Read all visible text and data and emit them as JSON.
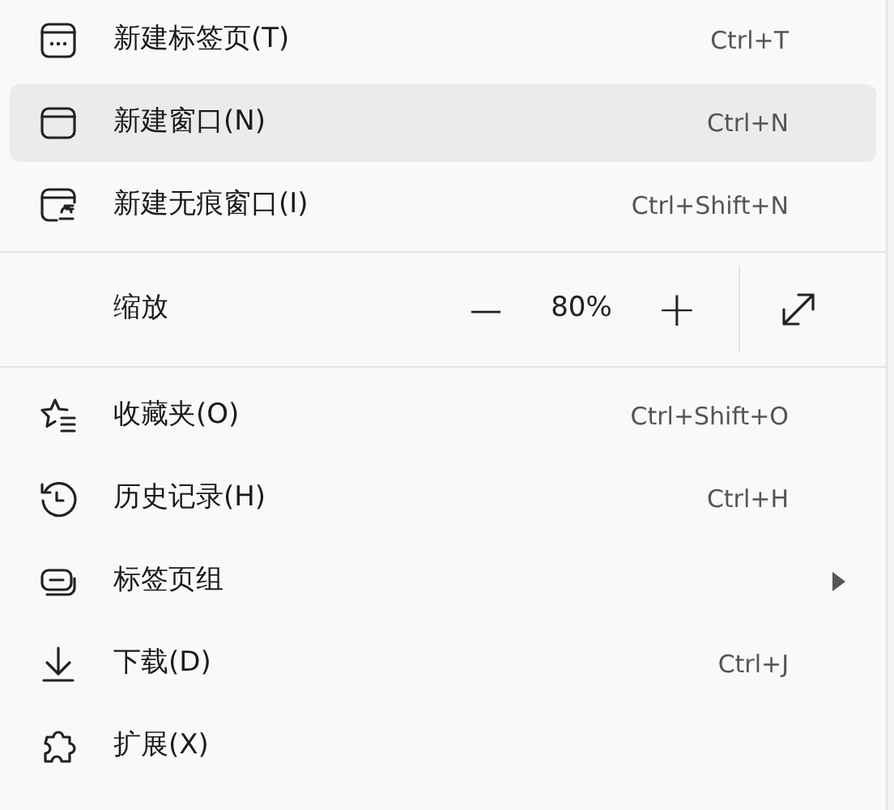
{
  "menu": [
    {
      "kind": "item",
      "label": "新建标签页(T)",
      "shortcut": "Ctrl+T",
      "selected": false
    },
    {
      "kind": "item",
      "label": "新建窗口(N)",
      "shortcut": "Ctrl+N",
      "selected": true
    },
    {
      "kind": "item",
      "label": "新建无痕窗口(I)",
      "shortcut": "Ctrl+Shift+N",
      "selected": false
    },
    {
      "kind": "separator"
    },
    {
      "kind": "zoom",
      "label": "缩放",
      "minus": "—",
      "value": "80%",
      "plus": "+"
    },
    {
      "kind": "separator"
    },
    {
      "kind": "item",
      "label": "收藏夹(O)",
      "shortcut": "Ctrl+Shift+O",
      "selected": false
    },
    {
      "kind": "item",
      "label": "历史记录(H)",
      "shortcut": "Ctrl+H",
      "selected": false
    },
    {
      "kind": "item",
      "label": "标签页组",
      "submenu": true,
      "selected": false
    },
    {
      "kind": "item",
      "label": "下载(D)",
      "shortcut": "Ctrl+J",
      "selected": false
    },
    {
      "kind": "item",
      "label": "扩展(X)",
      "selected": false
    }
  ]
}
